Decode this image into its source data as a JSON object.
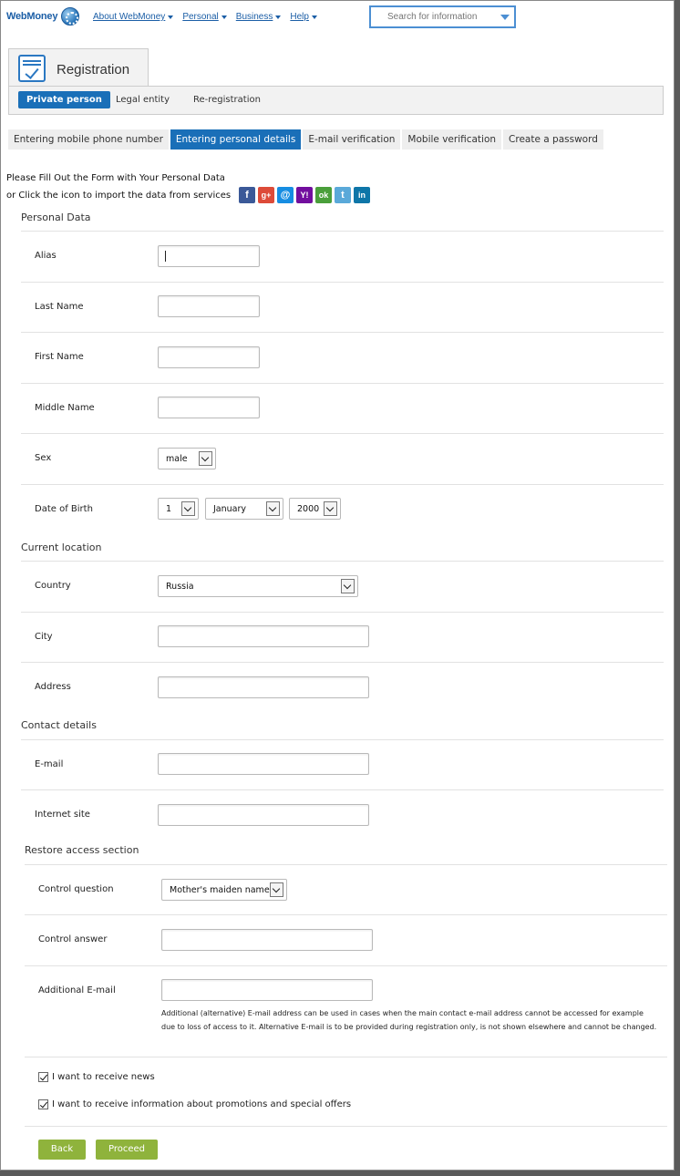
{
  "nav": {
    "logo": "WebMoney",
    "links": [
      "About WebMoney",
      "Personal",
      "Business",
      "Help"
    ],
    "search_placeholder": "Search for information"
  },
  "registration": {
    "title": "Registration",
    "subtabs": [
      "Private person",
      "Legal entity",
      "Re-registration"
    ],
    "active_subtab": "Private person"
  },
  "steps": {
    "items": [
      "Entering mobile phone number",
      "Entering personal details",
      "E-mail verification",
      "Mobile verification",
      "Create a password"
    ],
    "active": "Entering personal details"
  },
  "intro": {
    "line1": "Please Fill Out the Form with Your Personal Data",
    "line2": "or Click the icon to import the data from services",
    "services": [
      {
        "name": "facebook-icon",
        "glyph": "f",
        "color": "#3b5998"
      },
      {
        "name": "google-icon",
        "glyph": "g+",
        "color": "#dd4b39"
      },
      {
        "name": "myworld-icon",
        "glyph": "@",
        "color": "#168de2"
      },
      {
        "name": "yahoo-icon",
        "glyph": "Y!",
        "color": "#720e9e"
      },
      {
        "name": "odnoklassniki-icon",
        "glyph": "ok",
        "color": "#4a9f3b"
      },
      {
        "name": "twitter-icon",
        "glyph": "t",
        "color": "#5aa9d9"
      },
      {
        "name": "linkedin-icon",
        "glyph": "in",
        "color": "#0e76a8"
      }
    ]
  },
  "personal": {
    "title": "Personal Data",
    "alias_label": "Alias",
    "last_name_label": "Last Name",
    "first_name_label": "First Name",
    "middle_name_label": "Middle Name",
    "sex_label": "Sex",
    "sex_value": "male",
    "dob_label": "Date of Birth",
    "dob_day": "1",
    "dob_month": "January",
    "dob_year": "2000"
  },
  "location": {
    "title": "Current location",
    "country_label": "Country",
    "country_value": "Russia",
    "city_label": "City",
    "address_label": "Address"
  },
  "contact": {
    "title": "Contact details",
    "email_label": "E-mail",
    "site_label": "Internet site"
  },
  "restore": {
    "title": "Restore access section",
    "question_label": "Control question",
    "question_value": "Mother's maiden name",
    "answer_label": "Control answer",
    "additional_email_label": "Additional E-mail",
    "note": "Additional (alternative) E-mail address can be used in cases when the main contact e-mail address cannot be accessed for example due to loss of access to it. Alternative E-mail is to be provided during registration only, is not shown elsewhere and cannot be changed."
  },
  "options": {
    "news": "I want to receive news",
    "promo": "I want to receive information about promotions and special offers"
  },
  "buttons": {
    "back": "Back",
    "proceed": "Proceed"
  }
}
